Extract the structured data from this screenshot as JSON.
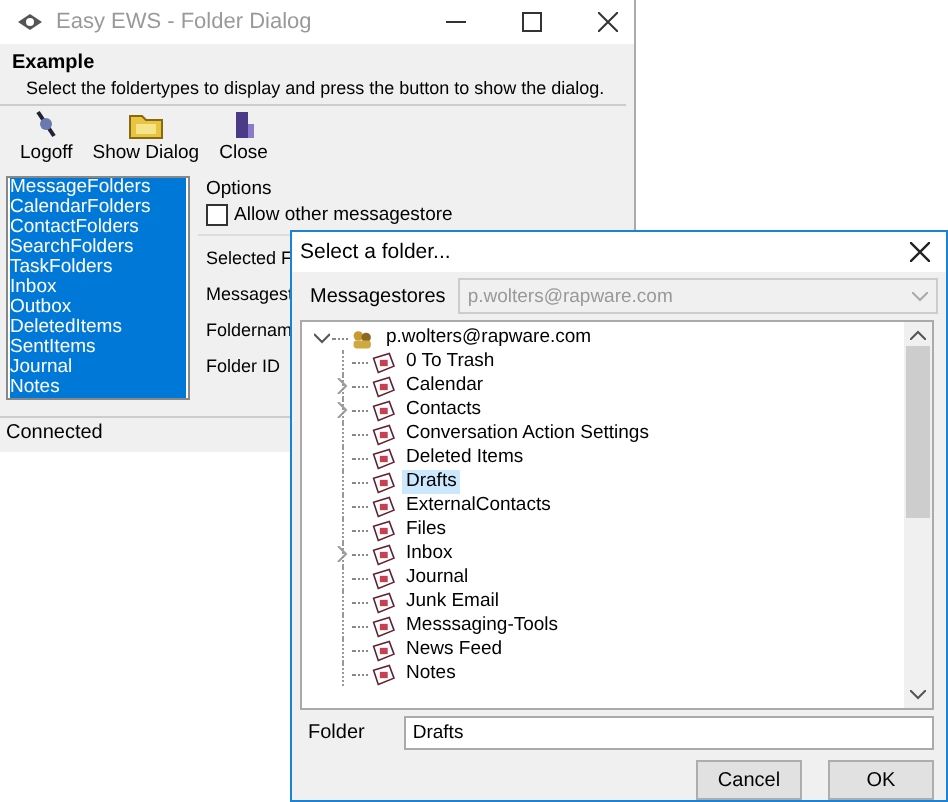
{
  "main_window": {
    "title": "Easy EWS - Folder Dialog",
    "heading": "Example",
    "description": "Select the foldertypes to display and press the button to show the dialog.",
    "toolbar": [
      {
        "kind": "logoff",
        "label": "Logoff"
      },
      {
        "kind": "dialog",
        "label": "Show Dialog"
      },
      {
        "kind": "close",
        "label": "Close"
      }
    ],
    "folder_types": [
      {
        "label": "MessageFolders",
        "selected": true
      },
      {
        "label": "CalendarFolders",
        "selected": true
      },
      {
        "label": "ContactFolders",
        "selected": true
      },
      {
        "label": "SearchFolders",
        "selected": true
      },
      {
        "label": "TaskFolders",
        "selected": true
      },
      {
        "label": "Inbox",
        "selected": true
      },
      {
        "label": "Outbox",
        "selected": true
      },
      {
        "label": "DeletedItems",
        "selected": true
      },
      {
        "label": "SentItems",
        "selected": true
      },
      {
        "label": "Journal",
        "selected": true
      },
      {
        "label": "Notes",
        "selected": true
      }
    ],
    "options": {
      "title": "Options",
      "checkbox": {
        "label": "Allow other messagestore",
        "checked": false
      }
    },
    "selected_group": {
      "title": "Selected F",
      "labels": [
        "Messagest",
        "Foldernam",
        "Folder ID"
      ]
    },
    "status_bar": "Connected"
  },
  "dialog": {
    "title": "Select a folder...",
    "messagestores_label": "Messagestores",
    "messagestores_value": "p.wolters@rapware.com",
    "tree": {
      "label": "p.wolters@rapware.com",
      "expanded": true,
      "children": [
        {
          "label": "0 To Trash",
          "expandable": false,
          "selected": false
        },
        {
          "label": "Calendar",
          "expandable": true,
          "selected": false
        },
        {
          "label": "Contacts",
          "expandable": true,
          "selected": false
        },
        {
          "label": "Conversation Action Settings",
          "expandable": false,
          "selected": false
        },
        {
          "label": "Deleted Items",
          "expandable": false,
          "selected": false
        },
        {
          "label": "Drafts",
          "expandable": false,
          "selected": true
        },
        {
          "label": "ExternalContacts",
          "expandable": false,
          "selected": false
        },
        {
          "label": "Files",
          "expandable": false,
          "selected": false
        },
        {
          "label": "Inbox",
          "expandable": true,
          "selected": false
        },
        {
          "label": "Journal",
          "expandable": false,
          "selected": false
        },
        {
          "label": "Junk Email",
          "expandable": false,
          "selected": false
        },
        {
          "label": "Messsaging-Tools",
          "expandable": false,
          "selected": false
        },
        {
          "label": "News Feed",
          "expandable": false,
          "selected": false
        },
        {
          "label": "Notes",
          "expandable": false,
          "selected": false
        }
      ]
    },
    "folder_label": "Folder",
    "folder_value": "Drafts",
    "buttons": [
      "Cancel",
      "OK"
    ]
  }
}
